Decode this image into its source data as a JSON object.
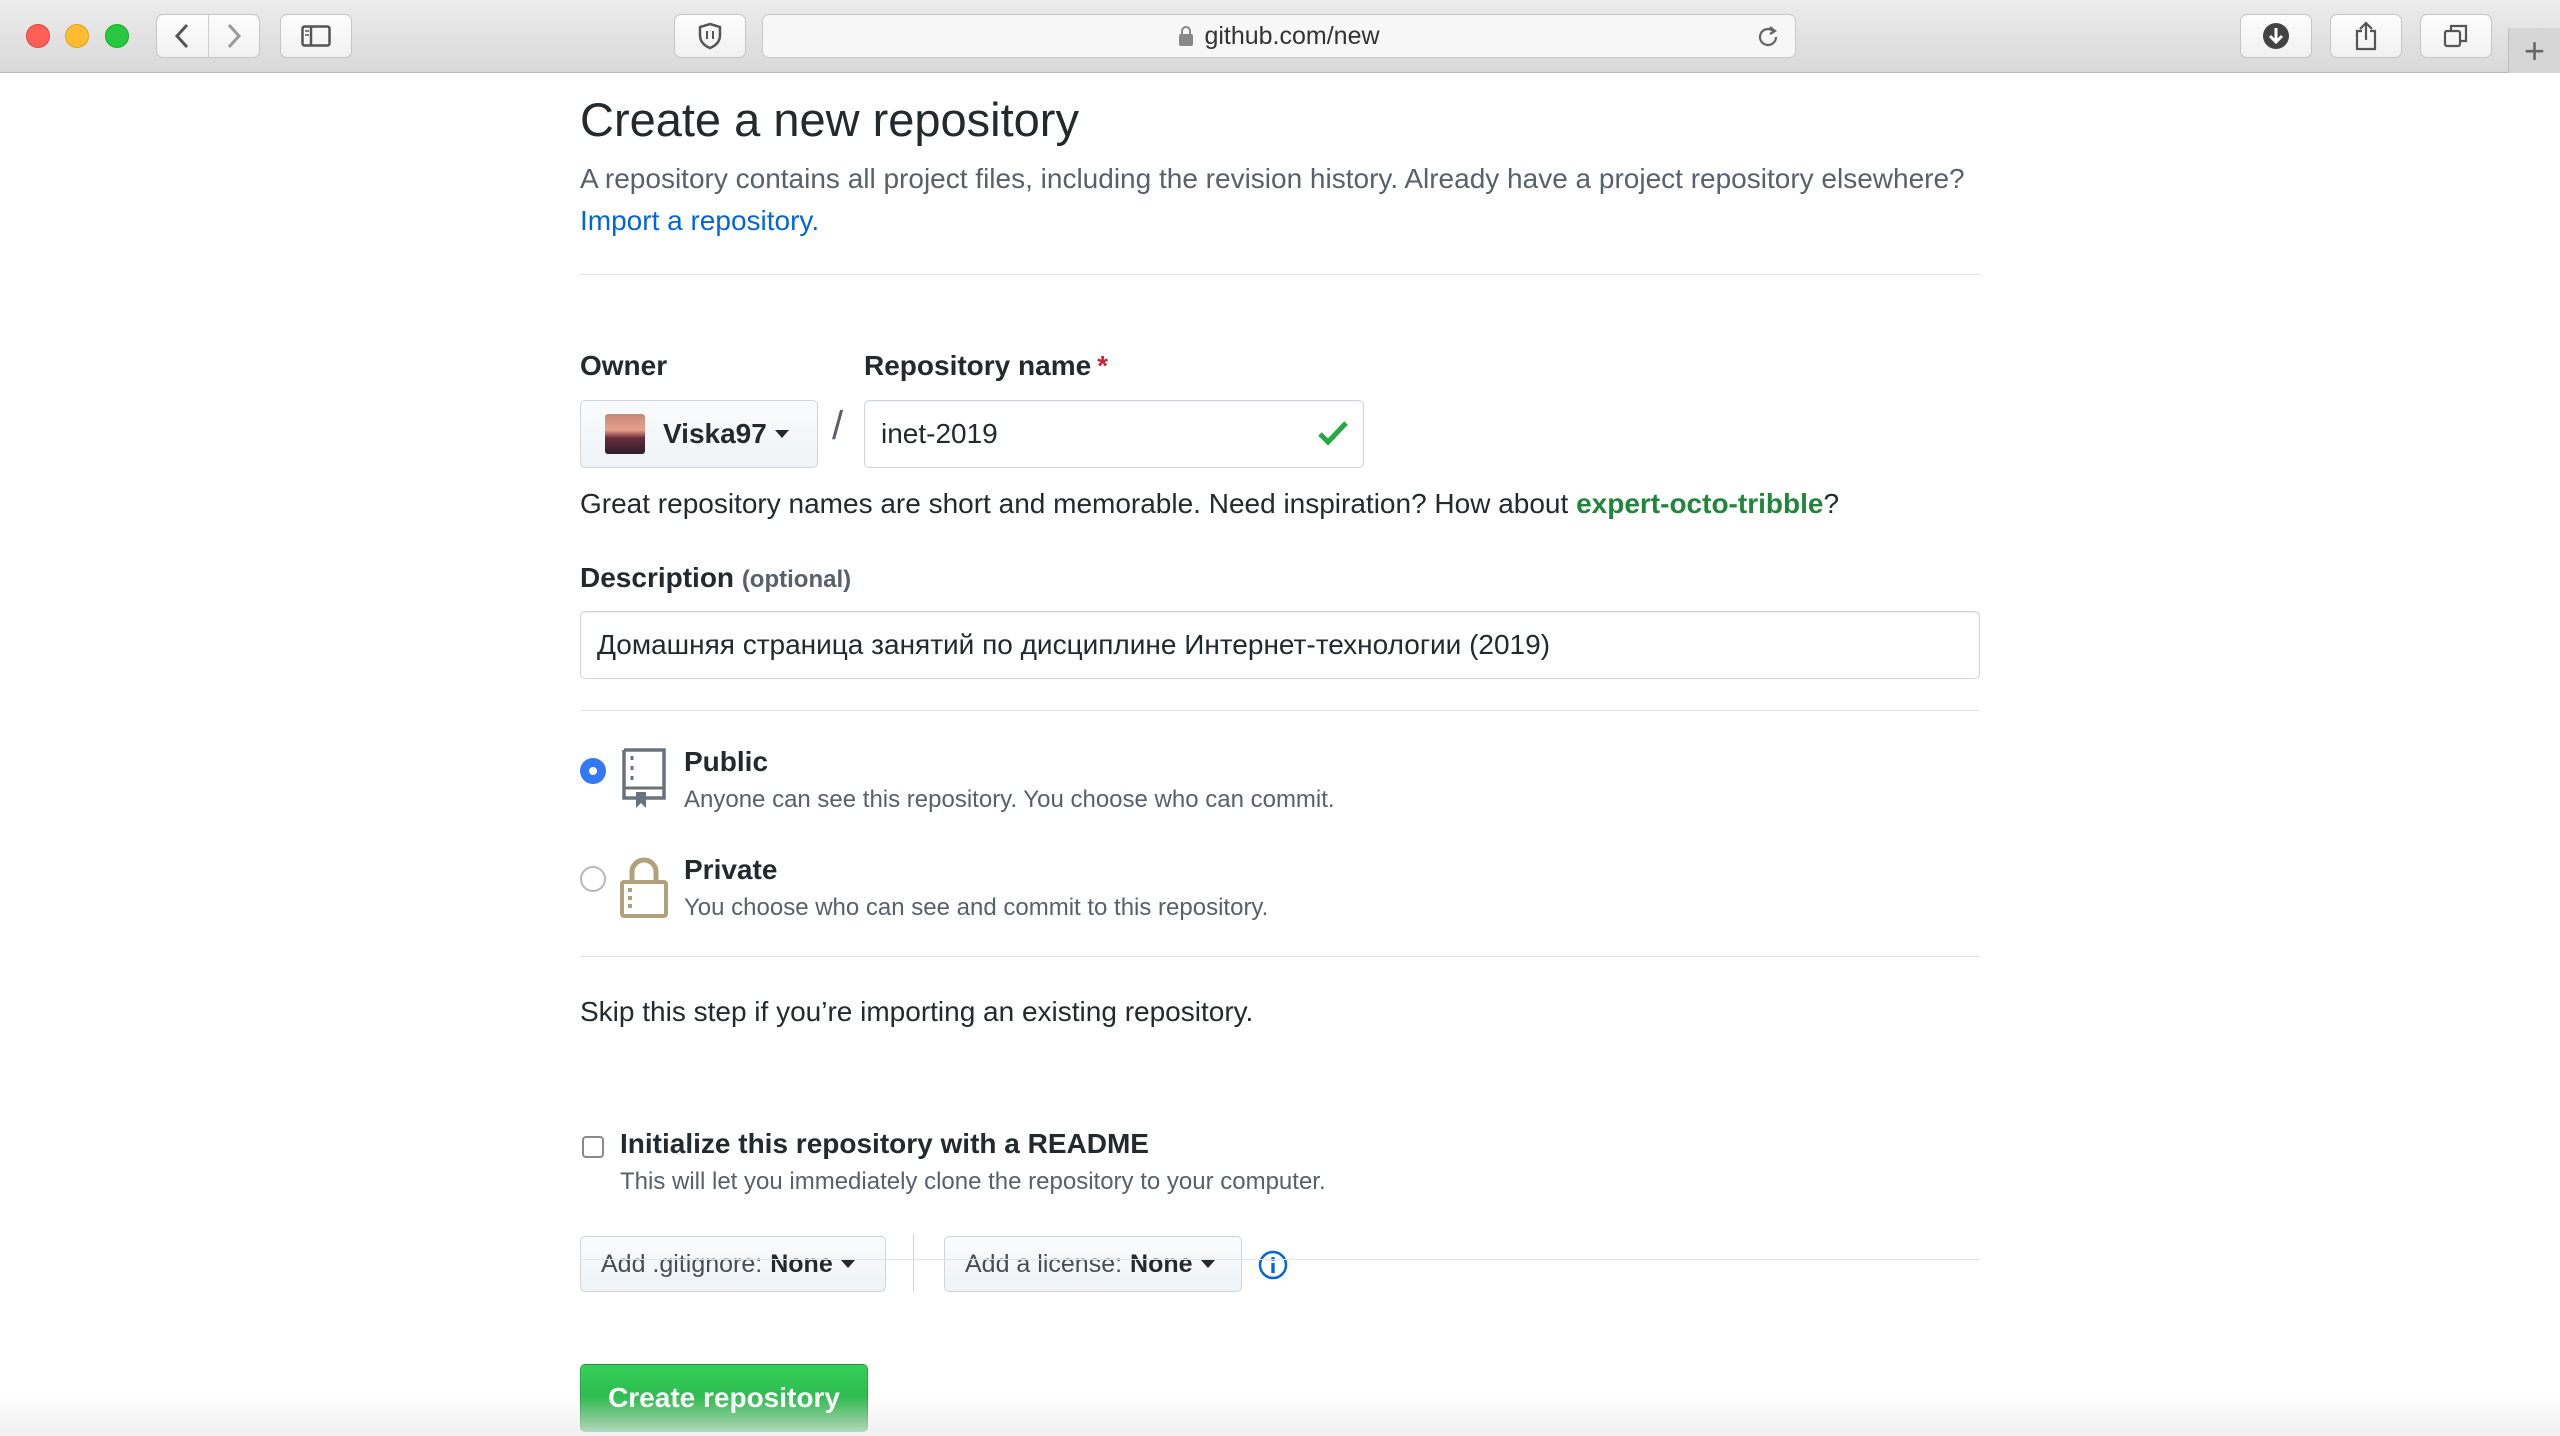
{
  "browser": {
    "url": "github.com/new",
    "new_tab_symbol": "+"
  },
  "page": {
    "title": "Create a new repository",
    "subhead_text": "A repository contains all project files, including the revision history. Already have a project repository elsewhere?",
    "import_link": "Import a repository."
  },
  "owner": {
    "label": "Owner",
    "value": "Viska97"
  },
  "repo_name": {
    "label": "Repository name",
    "required_mark": "*",
    "value": "inet-2019",
    "separator": "/"
  },
  "hint": {
    "text": "Great repository names are short and memorable. Need inspiration? How about",
    "suggestion": "expert-octo-tribble",
    "suffix": "?"
  },
  "description": {
    "label": "Description",
    "optional": "(optional)",
    "value": "Домашняя страница занятий по дисциплине Интернет-технологии (2019)"
  },
  "visibility": {
    "public": {
      "title": "Public",
      "desc": "Anyone can see this repository. You choose who can commit.",
      "selected": true
    },
    "private": {
      "title": "Private",
      "desc": "You choose who can see and commit to this repository.",
      "selected": false
    }
  },
  "init": {
    "skip_text": "Skip this step if you’re importing an existing repository.",
    "readme_title": "Initialize this repository with a README",
    "readme_desc": "This will let you immediately clone the repository to your computer.",
    "readme_checked": false
  },
  "gitignore": {
    "label": "Add .gitignore:",
    "value": "None"
  },
  "license": {
    "label": "Add a license:",
    "value": "None"
  },
  "submit": {
    "label": "Create repository"
  },
  "colors": {
    "link": "#0366d6",
    "suggestion": "#22863a",
    "primary_button": "#28a745",
    "required": "#cb2431",
    "radio_selected": "#3478f6"
  }
}
